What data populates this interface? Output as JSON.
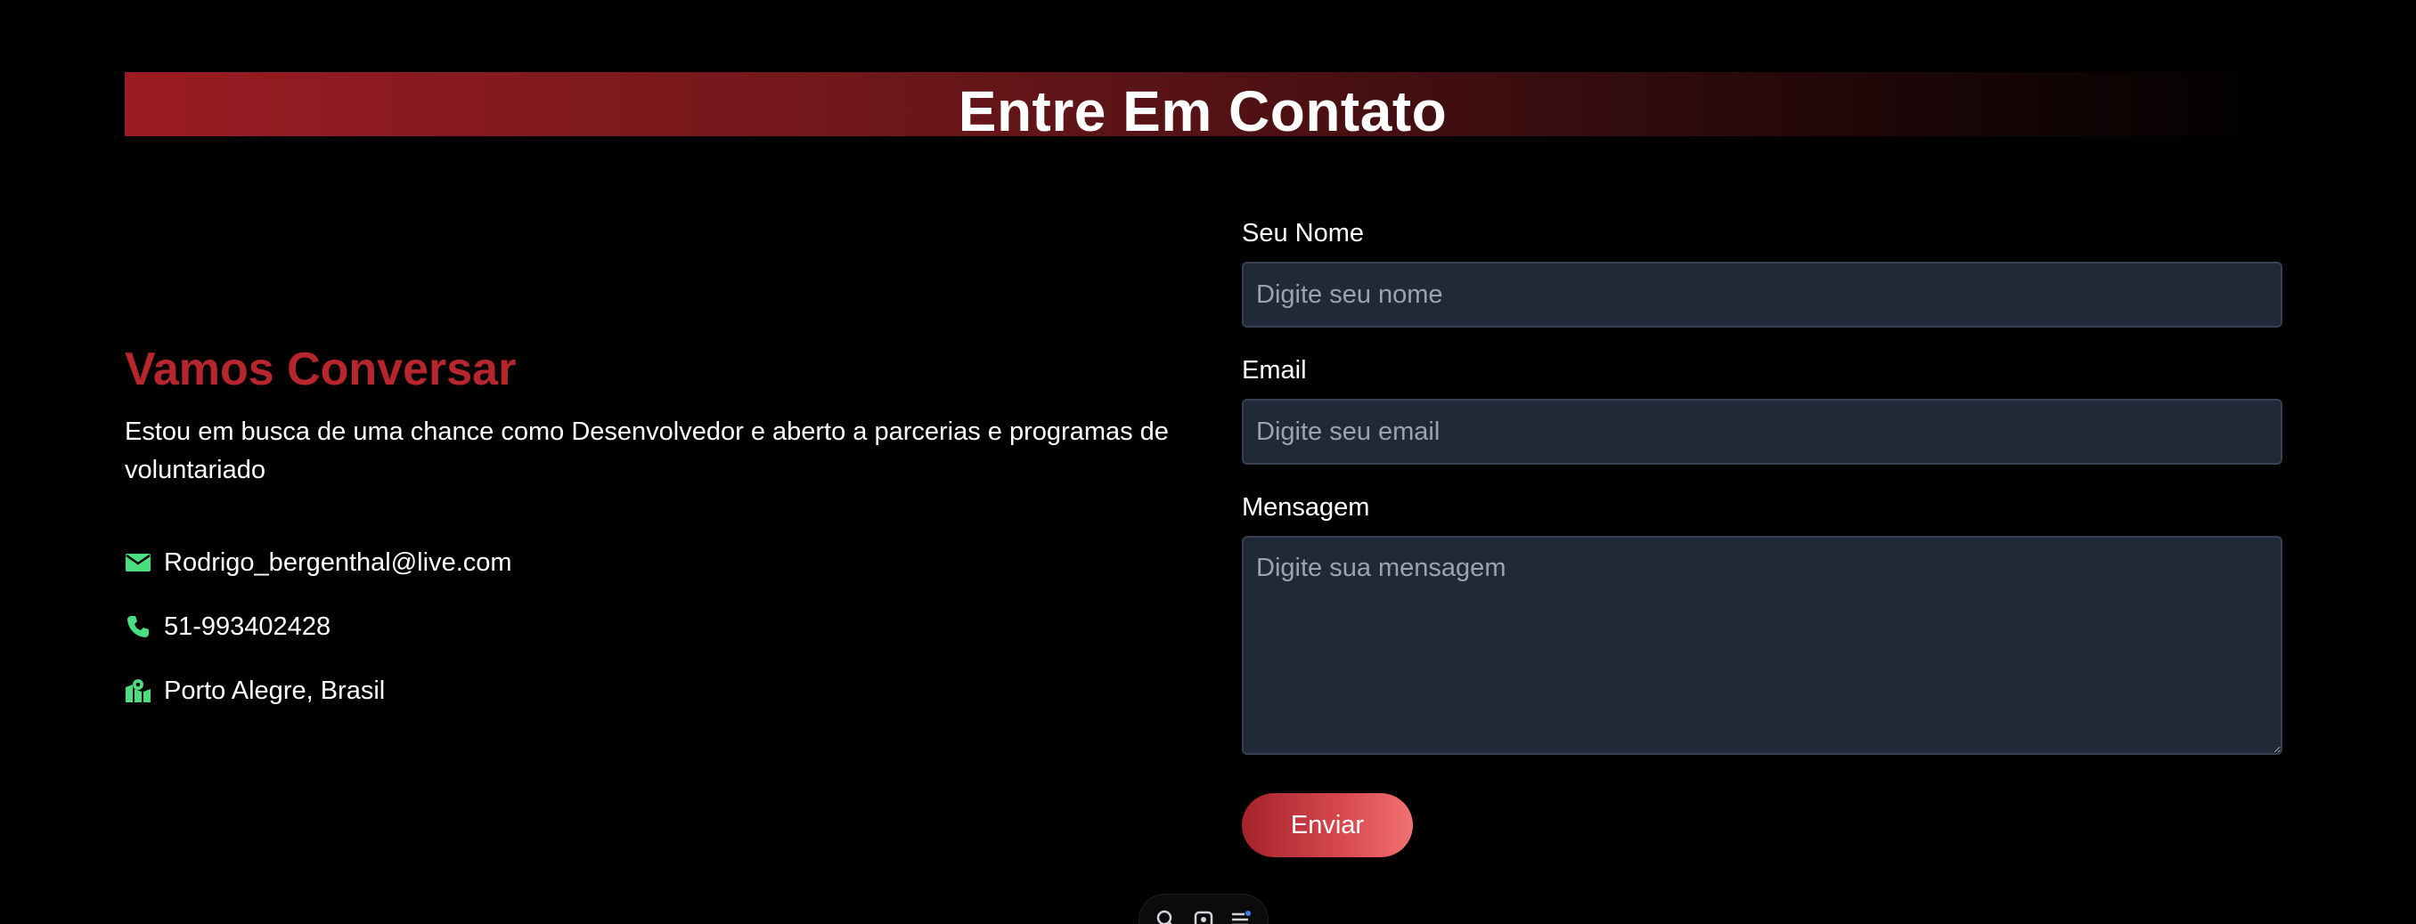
{
  "header": {
    "title": "Entre Em Contato"
  },
  "intro": {
    "heading": "Vamos Conversar",
    "text": "Estou em busca de uma chance como Desenvolvedor e aberto a parcerias e programas de voluntariado"
  },
  "contacts": [
    {
      "icon": "envelope-icon",
      "text": "Rodrigo_bergenthal@live.com"
    },
    {
      "icon": "phone-icon",
      "text": "51-993402428"
    },
    {
      "icon": "map-location-icon",
      "text": "Porto Alegre, Brasil"
    }
  ],
  "form": {
    "name_label": "Seu Nome",
    "name_placeholder": "Digite seu nome",
    "email_label": "Email",
    "email_placeholder": "Digite seu email",
    "message_label": "Mensagem",
    "message_placeholder": "Digite sua mensagem",
    "submit_label": "Enviar"
  },
  "dock": {
    "icons": [
      "search-icon",
      "screenshot-icon",
      "menu-icon"
    ]
  },
  "colors": {
    "accent": "#b8262d",
    "icon_green": "#4ade80",
    "input_bg": "#1f2937",
    "button_gradient_start": "#a3232a",
    "button_gradient_end": "#f07272"
  }
}
